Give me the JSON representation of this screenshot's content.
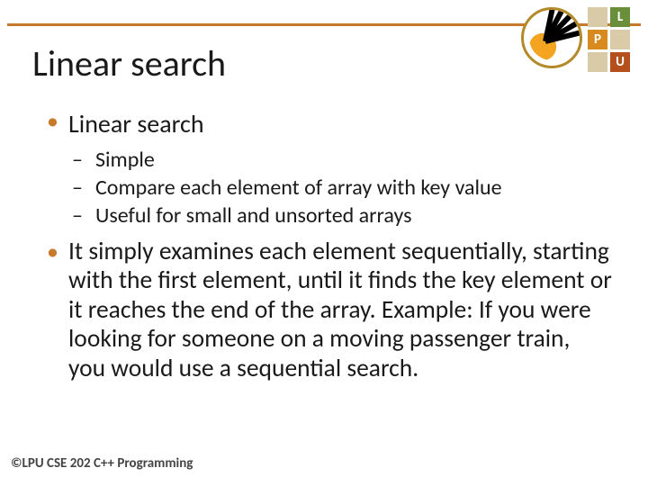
{
  "title": "Linear search",
  "logo": {
    "letters": [
      "L",
      "P",
      "U"
    ]
  },
  "bullets": {
    "main1": "Linear search",
    "sub": [
      "Simple",
      "Compare each element of array with key value",
      "Useful for small and unsorted arrays"
    ],
    "main2": "It simply examines each element sequentially, starting with the first element, until it finds the key element or it reaches the end of the array. Example: If you were looking for someone on a moving passenger train, you would use a sequential search."
  },
  "footer": "©LPU CSE 202 C++ Programming"
}
